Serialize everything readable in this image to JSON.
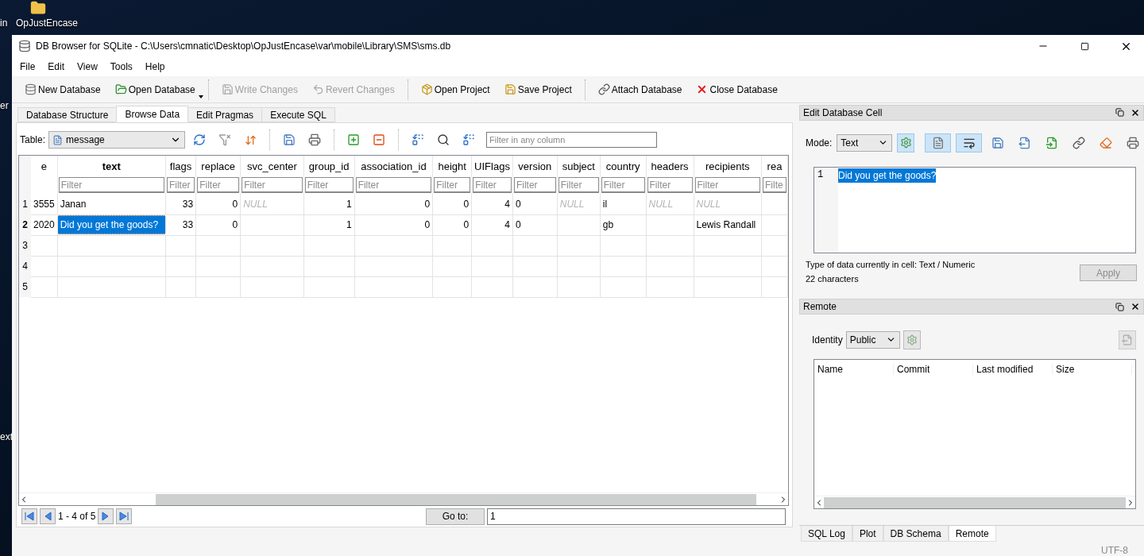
{
  "desktop": {
    "labels": [
      "in",
      "OpJustEncase",
      "er",
      "ext"
    ]
  },
  "window": {
    "title": "DB Browser for SQLite - C:\\Users\\cmnatic\\Desktop\\OpJustEncase\\var\\mobile\\Library\\SMS\\sms.db"
  },
  "menu": [
    "File",
    "Edit",
    "View",
    "Tools",
    "Help"
  ],
  "toolbar": [
    {
      "label": "New Database",
      "disabled": false,
      "dropdown": false
    },
    {
      "label": "Open Database",
      "disabled": false,
      "dropdown": true
    },
    {
      "label": "Write Changes",
      "disabled": true,
      "dropdown": false
    },
    {
      "label": "Revert Changes",
      "disabled": true,
      "dropdown": false
    },
    {
      "label": "Open Project",
      "disabled": false,
      "dropdown": false
    },
    {
      "label": "Save Project",
      "disabled": false,
      "dropdown": false
    },
    {
      "label": "Attach Database",
      "disabled": false,
      "dropdown": false
    },
    {
      "label": "Close Database",
      "disabled": false,
      "dropdown": false
    }
  ],
  "tabs": [
    {
      "label": "Database Structure",
      "selected": false
    },
    {
      "label": "Browse Data",
      "selected": true
    },
    {
      "label": "Edit Pragmas",
      "selected": false
    },
    {
      "label": "Execute SQL",
      "selected": false
    }
  ],
  "browse": {
    "table_label": "Table:",
    "table": "message",
    "filter_placeholder": "Filter in any column",
    "columns": [
      {
        "name": "e",
        "current": false
      },
      {
        "name": "text",
        "current": true,
        "placeholder": "Filter"
      },
      {
        "name": "flags",
        "current": false,
        "placeholder": "Filter"
      },
      {
        "name": "replace",
        "current": false,
        "placeholder": "Filter"
      },
      {
        "name": "svc_center",
        "current": false,
        "placeholder": "Filter"
      },
      {
        "name": "group_id",
        "current": false,
        "placeholder": "Filter"
      },
      {
        "name": "association_id",
        "current": false,
        "placeholder": "Filter"
      },
      {
        "name": "height",
        "current": false,
        "placeholder": "Filter"
      },
      {
        "name": "UIFlags",
        "current": false,
        "placeholder": "Filter"
      },
      {
        "name": "version",
        "current": false,
        "placeholder": "Filter"
      },
      {
        "name": "subject",
        "current": false,
        "placeholder": "Filter"
      },
      {
        "name": "country",
        "current": false,
        "placeholder": "Filter"
      },
      {
        "name": "headers",
        "current": false,
        "placeholder": "Filter"
      },
      {
        "name": "recipients",
        "current": false,
        "placeholder": "Filter"
      },
      {
        "name": "rea",
        "current": false,
        "placeholder": "Filte"
      }
    ],
    "rows": [
      {
        "number": "1",
        "current": false,
        "cells": [
          {
            "text": "3555",
            "kind": "number",
            "selected": false
          },
          {
            "text": "Janan",
            "kind": "text",
            "selected": false
          },
          {
            "text": "33",
            "kind": "number",
            "selected": false
          },
          {
            "text": "0",
            "kind": "number",
            "selected": false
          },
          {
            "text": "NULL",
            "kind": "null",
            "selected": false
          },
          {
            "text": "1",
            "kind": "number",
            "selected": false
          },
          {
            "text": "0",
            "kind": "number",
            "selected": false
          },
          {
            "text": "0",
            "kind": "number",
            "selected": false
          },
          {
            "text": "4",
            "kind": "number",
            "selected": false
          },
          {
            "text": "0",
            "kind": "text",
            "selected": false
          },
          {
            "text": "NULL",
            "kind": "null",
            "selected": false
          },
          {
            "text": "il",
            "kind": "text",
            "selected": false
          },
          {
            "text": "NULL",
            "kind": "null",
            "selected": false
          },
          {
            "text": "NULL",
            "kind": "null",
            "selected": false
          },
          {
            "kind": "empty",
            "selected": false
          }
        ]
      },
      {
        "number": "2",
        "current": true,
        "cells": [
          {
            "text": "2020",
            "kind": "number",
            "selected": false
          },
          {
            "text": "Did you get the goods?",
            "kind": "text",
            "selected": true
          },
          {
            "text": "33",
            "kind": "number",
            "selected": false
          },
          {
            "text": "0",
            "kind": "number",
            "selected": false
          },
          {
            "kind": "empty",
            "selected": false
          },
          {
            "text": "1",
            "kind": "number",
            "selected": false
          },
          {
            "text": "0",
            "kind": "number",
            "selected": false
          },
          {
            "text": "0",
            "kind": "number",
            "selected": false
          },
          {
            "text": "4",
            "kind": "number",
            "selected": false
          },
          {
            "text": "0",
            "kind": "text",
            "selected": false
          },
          {
            "kind": "empty",
            "selected": false
          },
          {
            "text": "gb",
            "kind": "text",
            "selected": false
          },
          {
            "kind": "empty",
            "selected": false
          },
          {
            "text": "Lewis Randall",
            "kind": "text",
            "selected": false
          },
          {
            "kind": "empty",
            "selected": false
          }
        ]
      },
      {
        "number": "3",
        "current": false
      },
      {
        "number": "4",
        "current": false
      },
      {
        "number": "5",
        "current": false
      }
    ],
    "pager": {
      "range": "1 - 4 of 5",
      "goto_label": "Go to:",
      "goto_value": "1"
    }
  },
  "edit_cell": {
    "title": "Edit Database Cell",
    "mode_label": "Mode:",
    "mode": "Text",
    "word_wrap": true,
    "auto_format": true,
    "line_number": "1",
    "content": "Did you get the goods?",
    "type_info": "Type of data currently in cell: Text / Numeric",
    "size_info": "22 characters",
    "apply": {
      "label": "Apply",
      "disabled": true
    }
  },
  "remote": {
    "title": "Remote",
    "identity_label": "Identity",
    "identity": "Public",
    "columns": [
      "Name",
      "Commit",
      "Last modified",
      "Size"
    ]
  },
  "dock_tabs": [
    {
      "label": "SQL Log",
      "selected": false
    },
    {
      "label": "Plot",
      "selected": false
    },
    {
      "label": "DB Schema",
      "selected": false
    },
    {
      "label": "Remote",
      "selected": true
    }
  ],
  "status_bar": {
    "encoding": "UTF-8"
  }
}
